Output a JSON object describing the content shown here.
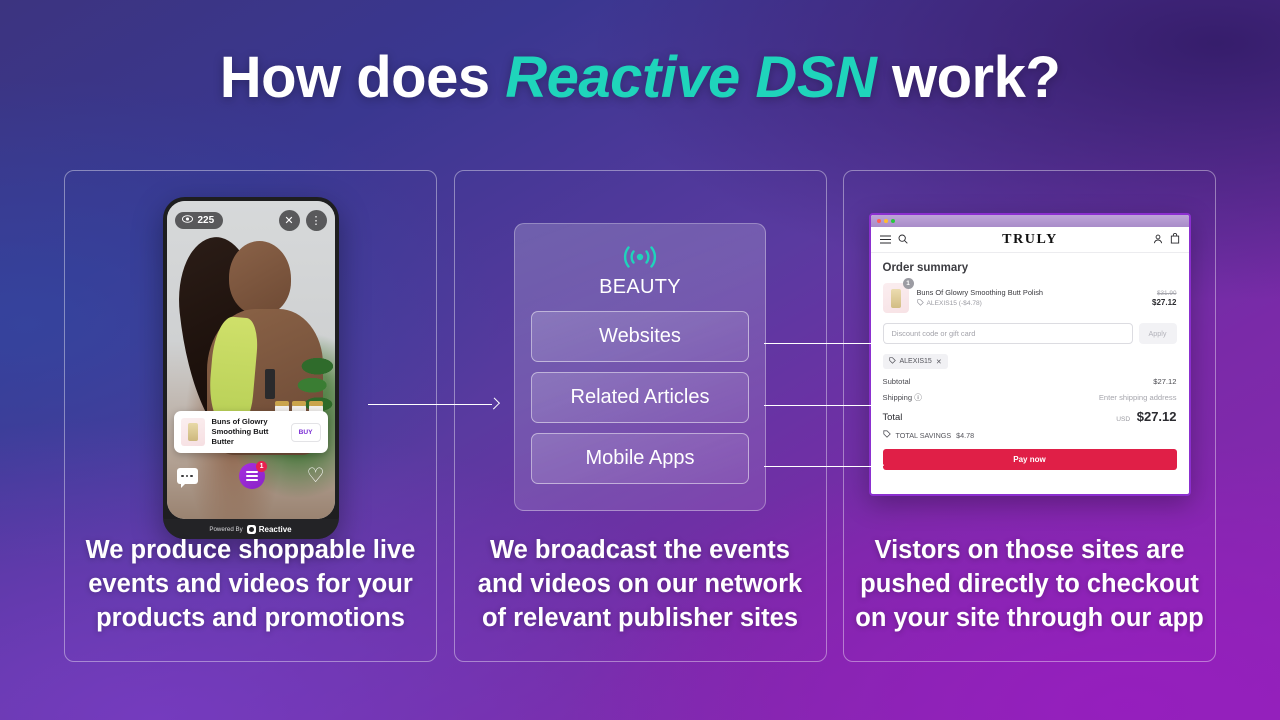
{
  "title": {
    "pre": "How does ",
    "accent": "Reactive DSN",
    "post": " work?"
  },
  "panels": [
    {
      "caption": "We produce shoppable live events and videos for your products and promotions"
    },
    {
      "caption": "We broadcast the events and videos on our network of relevant publisher sites"
    },
    {
      "caption": "Vistors on those sites are pushed directly to checkout on your site through our app"
    }
  ],
  "phone": {
    "viewers": "225",
    "viewer_icon": "eye-icon",
    "close_icon": "close-icon",
    "more_icon": "more-options-icon",
    "product_name": "Buns of Glowry Smoothing Butt Butter",
    "buy_label": "BUY",
    "cart_badge": "1",
    "powered_by": "Powered By",
    "brand": "Reactive"
  },
  "dsn": {
    "broadcast_icon": "broadcast-icon",
    "category": "BEAUTY",
    "channels": [
      "Websites",
      "Related Articles",
      "Mobile Apps"
    ],
    "accent": "#1fd4bb"
  },
  "checkout": {
    "store": "TRULY",
    "menu_icon": "hamburger-icon",
    "search_icon": "search-icon",
    "account_icon": "account-icon",
    "cart_icon": "cart-icon",
    "heading": "Order summary",
    "item": {
      "name": "Buns Of Glowry Smoothing Butt Polish",
      "discount_note": "ALEXIS15 (-$4.78)",
      "price_was": "$31.90",
      "price_now": "$27.12",
      "quantity": "1"
    },
    "discount_placeholder": "Discount code or gift card",
    "apply_label": "Apply",
    "applied_code": "ALEXIS15",
    "rows": [
      {
        "label": "Subtotal",
        "value": "$27.12",
        "muted": false
      },
      {
        "label": "Shipping",
        "value": "Enter shipping address",
        "muted": true
      }
    ],
    "total_label": "Total",
    "total_currency": "USD",
    "total_value": "$27.12",
    "savings_label": "TOTAL SAVINGS",
    "savings_value": "$4.78",
    "pay_label": "Pay now",
    "pay_color": "#e01f47"
  }
}
